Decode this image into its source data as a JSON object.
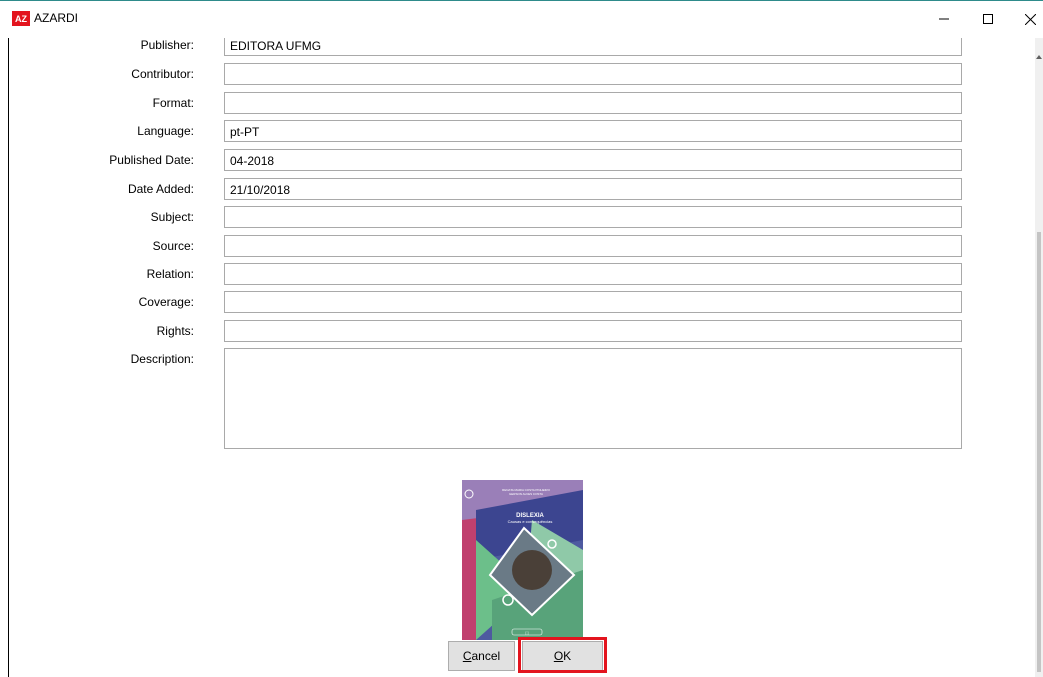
{
  "window": {
    "title": "AZARDI",
    "logo_text": "AZ",
    "controls": [
      "minimize-icon",
      "maximize-icon",
      "close-icon"
    ]
  },
  "form": {
    "fields": [
      {
        "label": "Publisher:",
        "value": "EDITORA UFMG"
      },
      {
        "label": "Contributor:",
        "value": ""
      },
      {
        "label": "Format:",
        "value": ""
      },
      {
        "label": "Language:",
        "value": "pt-PT"
      },
      {
        "label": "Published Date:",
        "value": "04-2018"
      },
      {
        "label": "Date Added:",
        "value": "21/10/2018"
      },
      {
        "label": "Subject:",
        "value": ""
      },
      {
        "label": "Source:",
        "value": ""
      },
      {
        "label": "Relation:",
        "value": ""
      },
      {
        "label": "Coverage:",
        "value": ""
      },
      {
        "label": "Rights:",
        "value": ""
      },
      {
        "label": "Description:",
        "value": ""
      }
    ]
  },
  "cover": {
    "authors_line1": "RENATA MARIA COSTA PINHEIRO",
    "authors_line2": "GERSON ALVES COSTA",
    "title": "DISLEXIA",
    "subtitle": "Causas e consequências",
    "footer": "[ ]"
  },
  "buttons": {
    "cancel_prefix": "C",
    "cancel_rest": "ancel",
    "ok_prefix": "O",
    "ok_rest": "K"
  },
  "colors": {
    "highlight": "#e3141e",
    "logo": "#e3141e"
  }
}
